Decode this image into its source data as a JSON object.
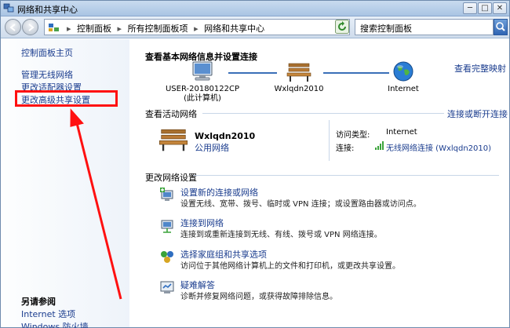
{
  "window": {
    "title": "网络和共享中心",
    "minimize": "─",
    "maximize": "□",
    "close": "✕"
  },
  "address": {
    "crumbs": [
      "控制面板",
      "所有控制面板项",
      "网络和共享中心"
    ],
    "separator": "▸",
    "search_placeholder": "搜索控制面板"
  },
  "sidebar": {
    "home": "控制面板主页",
    "wireless": "管理无线网络",
    "adapter": "更改适配器设置",
    "advanced": "更改高级共享设置",
    "see_also": "另请参阅",
    "internet_options": "Internet 选项",
    "firewall": "Windows 防火墙"
  },
  "main": {
    "basic_heading": "查看基本网络信息并设置连接",
    "full_map": "查看完整映射",
    "map": {
      "computer_name": "USER-20180122CP",
      "computer_sub": "(此计算机)",
      "network_name": "Wxlqdn2010",
      "internet": "Internet"
    },
    "active_heading": "查看活动网络",
    "connect_link": "连接或断开连接",
    "active": {
      "name": "Wxlqdn2010",
      "type": "公用网络",
      "access_label": "访问类型:",
      "access_value": "Internet",
      "conn_label": "连接:",
      "conn_value": "无线网络连接 (Wxlqdn2010)"
    },
    "change_heading": "更改网络设置",
    "tasks": [
      {
        "title": "设置新的连接或网络",
        "desc": "设置无线、宽带、拨号、临时或 VPN 连接；或设置路由器或访问点。"
      },
      {
        "title": "连接到网络",
        "desc": "连接到或重新连接到无线、有线、拨号或 VPN 网络连接。"
      },
      {
        "title": "选择家庭组和共享选项",
        "desc": "访问位于其他网络计算机上的文件和打印机，或更改共享设置。"
      },
      {
        "title": "疑难解答",
        "desc": "诊断并修复网络问题，或获得故障排除信息。"
      }
    ]
  },
  "colors": {
    "link": "#1a3c8e",
    "annotation": "#ff1010"
  }
}
